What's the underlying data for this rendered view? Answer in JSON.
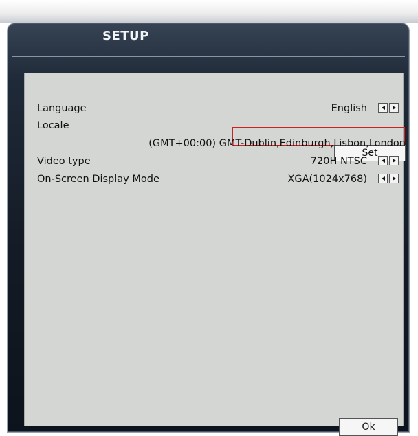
{
  "window": {
    "title": "SETUP"
  },
  "settings": {
    "language": {
      "label": "Language",
      "value": "English"
    },
    "locale": {
      "label": "Locale",
      "button_label": "Set",
      "value": "(GMT+00:00) GMT-Dublin,Edinburgh,Lisbon,London"
    },
    "video_type": {
      "label": "Video type",
      "value": "720H NTSC"
    },
    "osd_mode": {
      "label": "On-Screen Display Mode",
      "value": "XGA(1024x768)"
    }
  },
  "footer": {
    "ok_label": "Ok"
  },
  "colors": {
    "panel_bg": "#d4d6d3",
    "window_frame": "#1f2a38",
    "focus_highlight": "#d02020"
  },
  "icons": {
    "prev": "triangle-left-icon",
    "next": "triangle-right-icon"
  }
}
